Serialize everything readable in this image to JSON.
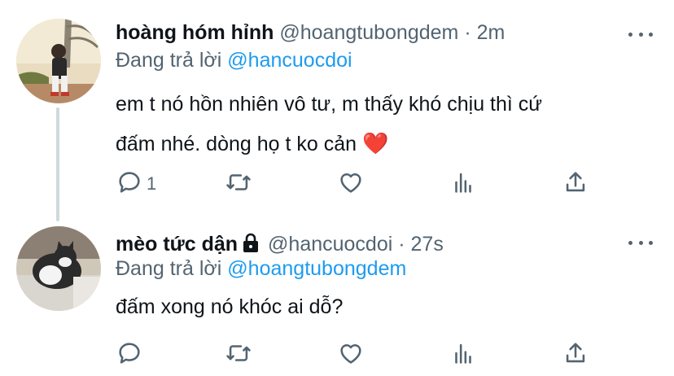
{
  "tweets": [
    {
      "name": "hoàng hóm hỉnh",
      "handle": "@hoangtubongdem",
      "separator": "·",
      "time": "2m",
      "replying_prefix": "Đang trả lời",
      "replying_to": "@hancuocdoi",
      "text_line1": "em t nó hồn nhiên vô tư, m thấy khó chịu thì cứ",
      "text_line2": "đấm nhé. dòng họ t ko cản",
      "emoji": "❤️",
      "reply_count": "1",
      "protected": false
    },
    {
      "name": "mèo tức dận",
      "handle": "@hancuocdoi",
      "separator": "·",
      "time": "27s",
      "replying_prefix": "Đang trả lời",
      "replying_to": "@hoangtubongdem",
      "text_line1": "đấm xong nó khóc ai dỗ?",
      "protected": true
    }
  ],
  "icons": {
    "reply": "reply-icon",
    "retweet": "retweet-icon",
    "like": "like-icon",
    "analytics": "analytics-icon",
    "share": "share-icon",
    "more": "more-icon",
    "lock": "lock-icon"
  },
  "colors": {
    "accent": "#1d9bf0",
    "text": "#0f1419",
    "secondary": "#536471",
    "thread_line": "#cfd9de",
    "heart": "#e0245e"
  }
}
